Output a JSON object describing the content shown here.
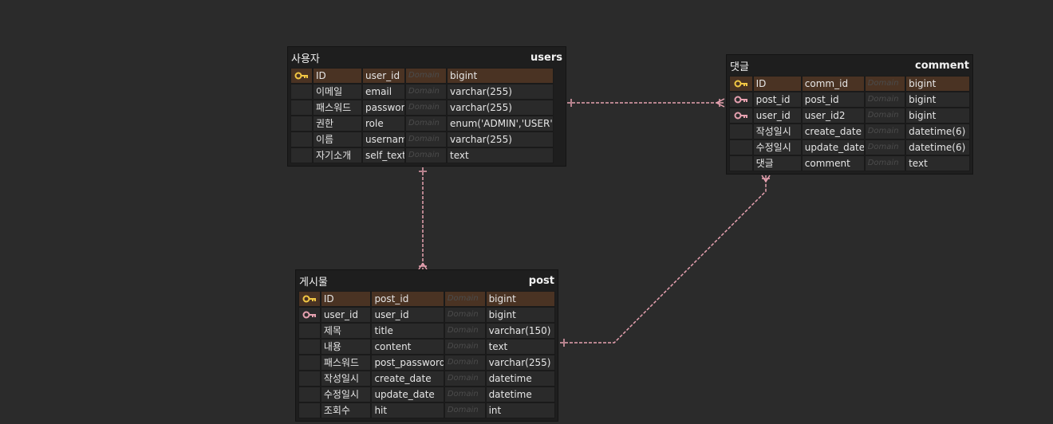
{
  "colors": {
    "background": "#2b2b2b",
    "pk_row": "#4a3323",
    "pk_key": "#f2c744",
    "fk_key": "#e6a1b0",
    "relation_line": "#e6a1b0"
  },
  "domain_placeholder": "Domain",
  "entities": {
    "users": {
      "logical": "사용자",
      "physical": "users",
      "columns": [
        {
          "logical": "ID",
          "physical": "user_id",
          "type": "bigint",
          "key": "pk"
        },
        {
          "logical": "이메일",
          "physical": "email",
          "type": "varchar(255)",
          "key": ""
        },
        {
          "logical": "패스워드",
          "physical": "password",
          "type": "varchar(255)",
          "key": ""
        },
        {
          "logical": "권한",
          "physical": "role",
          "type": "enum('ADMIN','USER')",
          "key": ""
        },
        {
          "logical": "이름",
          "physical": "username",
          "type": "varchar(255)",
          "key": ""
        },
        {
          "logical": "자기소개",
          "physical": "self_text",
          "type": "text",
          "key": ""
        }
      ]
    },
    "comment": {
      "logical": "댓글",
      "physical": "comment",
      "columns": [
        {
          "logical": "ID",
          "physical": "comm_id",
          "type": "bigint",
          "key": "pk"
        },
        {
          "logical": "post_id",
          "physical": "post_id",
          "type": "bigint",
          "key": "fk"
        },
        {
          "logical": "user_id",
          "physical": "user_id2",
          "type": "bigint",
          "key": "fk"
        },
        {
          "logical": "작성일시",
          "physical": "create_date",
          "type": "datetime(6)",
          "key": ""
        },
        {
          "logical": "수정일시",
          "physical": "update_date",
          "type": "datetime(6)",
          "key": ""
        },
        {
          "logical": "댓글",
          "physical": "comment",
          "type": "text",
          "key": ""
        }
      ]
    },
    "post": {
      "logical": "게시물",
      "physical": "post",
      "columns": [
        {
          "logical": "ID",
          "physical": "post_id",
          "type": "bigint",
          "key": "pk"
        },
        {
          "logical": "user_id",
          "physical": "user_id",
          "type": "bigint",
          "key": "fk"
        },
        {
          "logical": "제목",
          "physical": "title",
          "type": "varchar(150)",
          "key": ""
        },
        {
          "logical": "내용",
          "physical": "content",
          "type": "text",
          "key": ""
        },
        {
          "logical": "패스워드",
          "physical": "post_password",
          "type": "varchar(255)",
          "key": ""
        },
        {
          "logical": "작성일시",
          "physical": "create_date",
          "type": "datetime",
          "key": ""
        },
        {
          "logical": "수정일시",
          "physical": "update_date",
          "type": "datetime",
          "key": ""
        },
        {
          "logical": "조회수",
          "physical": "hit",
          "type": "int",
          "key": ""
        }
      ]
    }
  },
  "relationships": [
    {
      "from": "users",
      "to": "comment",
      "type": "one-to-many"
    },
    {
      "from": "users",
      "to": "post",
      "type": "one-to-many"
    },
    {
      "from": "post",
      "to": "comment",
      "type": "one-to-many"
    }
  ]
}
